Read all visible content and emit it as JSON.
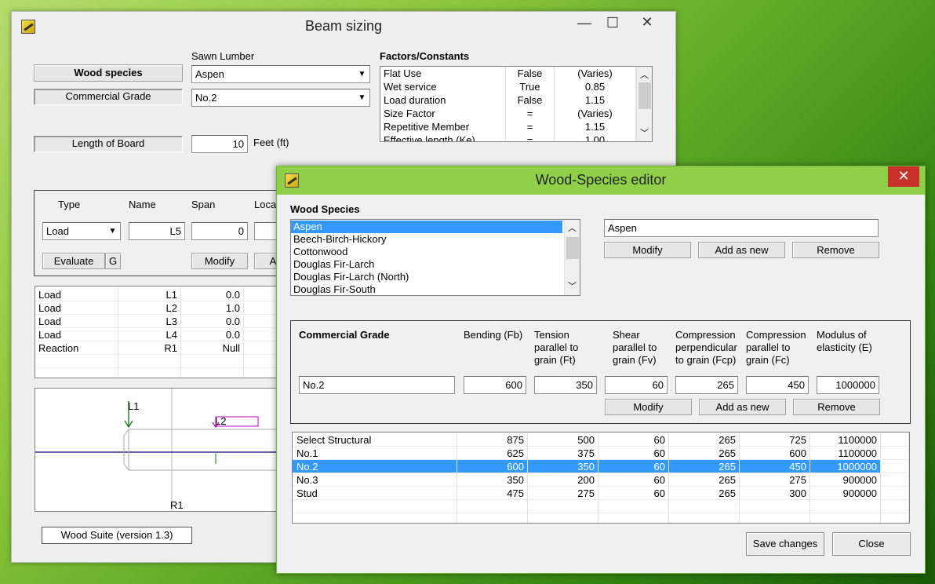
{
  "beam_window": {
    "title": "Beam sizing",
    "controls": {
      "minimize": "—",
      "maximize": "☐",
      "close": "✕"
    },
    "wood_species_button": "Wood species",
    "commercial_grade_label": "Commercial Grade",
    "sawn_lumber_label": "Sawn Lumber",
    "species_value": "Aspen",
    "grade_value": "No.2",
    "length_label": "Length of Board",
    "length_value": "10",
    "length_unit": "Feet (ft)",
    "factors": {
      "title": "Factors/Constants",
      "rows": [
        [
          "Flat Use",
          "False",
          "(Varies)"
        ],
        [
          "Wet service",
          "True",
          "0.85"
        ],
        [
          "Load duration",
          "False",
          "1.15"
        ],
        [
          "Size Factor",
          "=",
          "(Varies)"
        ],
        [
          "Repetitive Member",
          "=",
          "1.15"
        ],
        [
          "Effective length (Ke)",
          "=",
          "1.00"
        ]
      ]
    },
    "load_panel": {
      "type_label": "Type",
      "name_label": "Name",
      "span_label": "Span",
      "loc_label": "Loca",
      "type_value": "Load",
      "name_value": "L5",
      "span_value": "0",
      "evaluate_button": "Evaluate",
      "g_button": "G",
      "modify_button": "Modify",
      "a_button": "A"
    },
    "loads_table": [
      [
        "Load",
        "L1",
        "0.0"
      ],
      [
        "Load",
        "L2",
        "1.0"
      ],
      [
        "Load",
        "L3",
        "0.0"
      ],
      [
        "Load",
        "L4",
        "0.0"
      ],
      [
        "Reaction",
        "R1",
        "Null"
      ]
    ],
    "diagram": {
      "l1": "L1",
      "l2": "L2",
      "r1": "R1"
    },
    "version": "Wood Suite (version 1.3)"
  },
  "editor_window": {
    "title": "Wood-Species editor",
    "close": "✕",
    "species_header": "Wood Species",
    "species_list": [
      "Aspen",
      "Beech-Birch-Hickory",
      "Cottonwood",
      "Douglas Fir-Larch",
      "Douglas Fir-Larch (North)",
      "Douglas Fir-South"
    ],
    "species_selected_index": 0,
    "species_name_value": "Aspen",
    "species_buttons": {
      "modify": "Modify",
      "add": "Add as new",
      "remove": "Remove"
    },
    "grade": {
      "header": "Commercial Grade",
      "columns": [
        "Bending (Fb)",
        "Tension parallel to grain (Ft)",
        "Shear parallel to grain (Fv)",
        "Compression perpendicular to grain (Fcp)",
        "Compression parallel to grain (Fc)",
        "Modulus of elasticity (E)"
      ],
      "inputs": {
        "name": "No.2",
        "fb": "600",
        "ft": "350",
        "fv": "60",
        "fcp": "265",
        "fc": "450",
        "e": "1000000"
      },
      "buttons": {
        "modify": "Modify",
        "add": "Add as new",
        "remove": "Remove"
      }
    },
    "grades_table": [
      [
        "Select Structural",
        "875",
        "500",
        "60",
        "265",
        "725",
        "1100000"
      ],
      [
        "No.1",
        "625",
        "375",
        "60",
        "265",
        "600",
        "1100000"
      ],
      [
        "No.2",
        "600",
        "350",
        "60",
        "265",
        "450",
        "1000000"
      ],
      [
        "No.3",
        "350",
        "200",
        "60",
        "265",
        "275",
        "900000"
      ],
      [
        "Stud",
        "475",
        "275",
        "60",
        "265",
        "300",
        "900000"
      ]
    ],
    "grades_selected_index": 2,
    "save_button": "Save changes",
    "close_button": "Close"
  }
}
